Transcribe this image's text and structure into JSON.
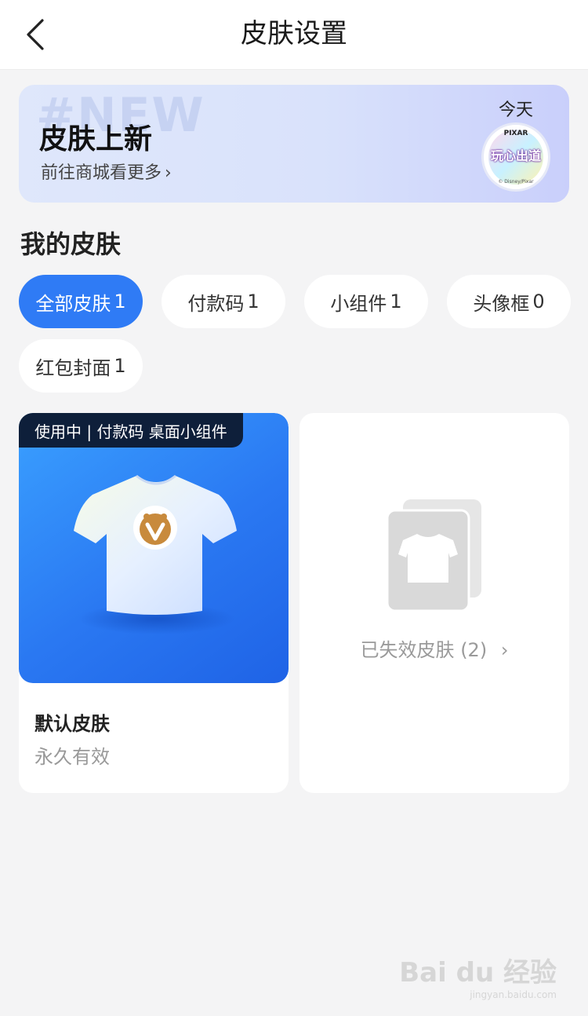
{
  "header": {
    "title": "皮肤设置"
  },
  "banner": {
    "watermark": "#NEW",
    "title": "皮肤上新",
    "subtitle": "前往商城看更多",
    "subtitle_chevron": "›",
    "date_label": "今天",
    "badge_top": "PIXAR",
    "badge_text": "玩心出道",
    "badge_bottom": "© Disney/Pixar"
  },
  "section": {
    "title": "我的皮肤"
  },
  "filters": [
    {
      "label": "全部皮肤",
      "count": "1",
      "active": true
    },
    {
      "label": "付款码",
      "count": "1",
      "active": false
    },
    {
      "label": "小组件",
      "count": "1",
      "active": false
    },
    {
      "label": "头像框",
      "count": "0",
      "active": false
    },
    {
      "label": "红包封面",
      "count": "1",
      "active": false
    }
  ],
  "skin_card": {
    "status": "使用中 | 付款码 桌面小组件",
    "name": "默认皮肤",
    "validity": "永久有效"
  },
  "expired_card": {
    "label": "已失效皮肤 (2)",
    "chevron": "›"
  },
  "watermark": {
    "line1": "Bai du 经验",
    "line2": "jingyan.baidu.com"
  },
  "colors": {
    "accent": "#2f7bf5",
    "background": "#f4f4f5"
  }
}
